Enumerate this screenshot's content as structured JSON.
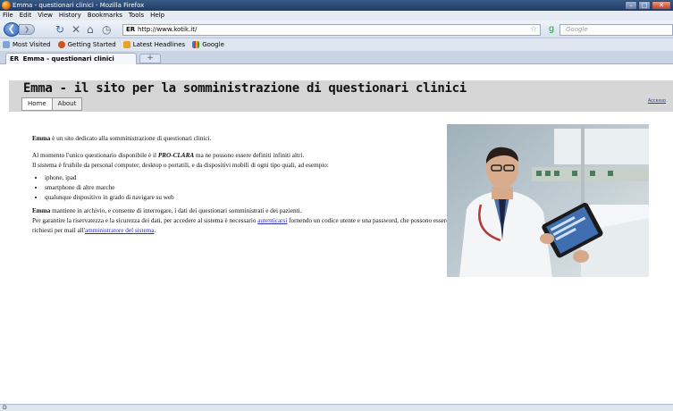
{
  "window": {
    "title": "Emma - questionari clinici - Mozilla Firefox"
  },
  "menubar": [
    "File",
    "Edit",
    "View",
    "History",
    "Bookmarks",
    "Tools",
    "Help"
  ],
  "navbar": {
    "url": "http://www.kotik.it/",
    "search_placeholder": "Google"
  },
  "bookmarks": [
    "Most Visited",
    "Getting Started",
    "Latest Headlines",
    "Google"
  ],
  "tab": {
    "title": "Emma - questionari clinici",
    "new_tab_label": "+"
  },
  "page": {
    "site_title": "Emma - il sito per la somministrazione di questionari clinici",
    "menu": [
      "Home",
      "About"
    ],
    "access_link": "Accesso",
    "intro_name": "Emma",
    "intro_text": " è un sito dedicato alla somministrazione di questionari clinici.",
    "p2_text1": "Al momento l'unico questionario disponibile è il ",
    "p2_bold": "PRO-CLARA",
    "p2_text2": " ma ne possono essere definiti infiniti altri.",
    "p3_text": "Il sistema è fruibile da personal computer, desktop o portatili, e da dispositivi mobili di ogni tipo quali, ad esempio:",
    "list": [
      "iphone, ipad",
      "smartphone di altre marche",
      "qualunque dispositivo in grado di navigare su web"
    ],
    "p4_name": "Emma",
    "p4_text": " mantiene in archivio, e consente di interrogare, i dati dei questionari somministrati e dei pazienti.",
    "p5_text1": "Per garantire la riservatezza e la sicurezza dei dati, per accedere al sistema è necessario ",
    "p5_link1": "autenticarsi",
    "p5_text2": " fornendo un codice utente e una password, che possono essere richiesti per mail all'",
    "p5_link2": "amministratore del sistema",
    "p5_text3": "."
  },
  "statusbar": {
    "text": "D"
  },
  "colors": {
    "header_bg": "#d6d6d6",
    "link": "#2b2bb8",
    "titlebar": "#1f3b63"
  }
}
